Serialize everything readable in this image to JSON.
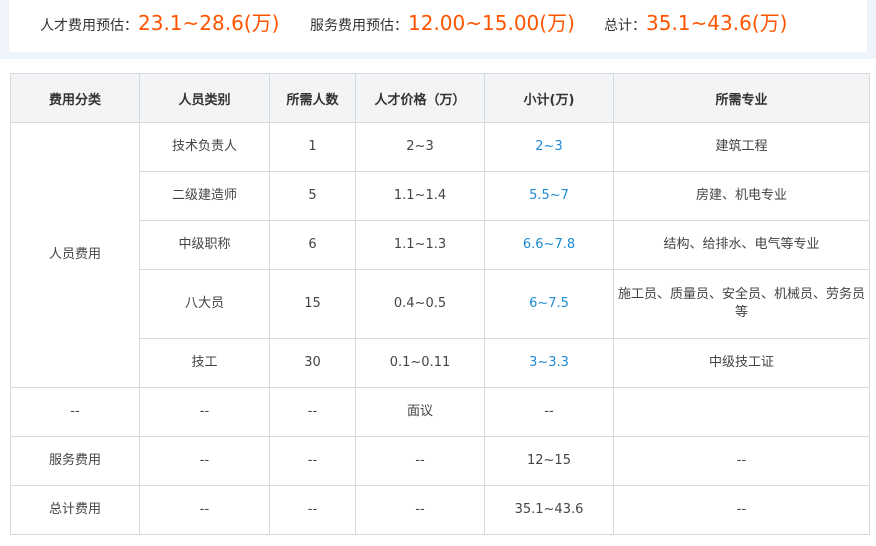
{
  "summary": {
    "talent_label": "人才费用预估：",
    "talent_value": "23.1~28.6(万)",
    "service_label": "服务费用预估：",
    "service_value": "12.00~15.00(万)",
    "total_label": "总计：",
    "total_value": "35.1~43.6(万)"
  },
  "table": {
    "headers": [
      "费用分类",
      "人员类别",
      "所需人数",
      "人才价格（万）",
      "小计(万)",
      "所需专业"
    ],
    "personnel_category": "人员费用",
    "personnel_rows": [
      {
        "type": "技术负责人",
        "count": "1",
        "price": "2~3",
        "subtotal": "2~3",
        "major": "建筑工程"
      },
      {
        "type": "二级建造师",
        "count": "5",
        "price": "1.1~1.4",
        "subtotal": "5.5~7",
        "major": "房建、机电专业"
      },
      {
        "type": "中级职称",
        "count": "6",
        "price": "1.1~1.3",
        "subtotal": "6.6~7.8",
        "major": "结构、给排水、电气等专业"
      },
      {
        "type": "八大员",
        "count": "15",
        "price": "0.4~0.5",
        "subtotal": "6~7.5",
        "major": "施工员、质量员、安全员、机械员、劳务员等"
      },
      {
        "type": "技工",
        "count": "30",
        "price": "0.1~0.11",
        "subtotal": "3~3.3",
        "major": "中级技工证"
      }
    ],
    "other_row": {
      "category": "--",
      "type": "--",
      "count": "--",
      "price": "面议",
      "subtotal": "--",
      "major": ""
    },
    "service_row": {
      "category": "服务费用",
      "type": "--",
      "count": "--",
      "price": "--",
      "subtotal": "12~15",
      "major": "--"
    },
    "total_row": {
      "category": "总计费用",
      "type": "--",
      "count": "--",
      "price": "--",
      "subtotal": "35.1~43.6",
      "major": "--"
    }
  },
  "colors": {
    "accent": "#ff5500",
    "link": "#1e8bd2",
    "header_bg": "#f3f4f6",
    "border": "#d6d9de"
  }
}
